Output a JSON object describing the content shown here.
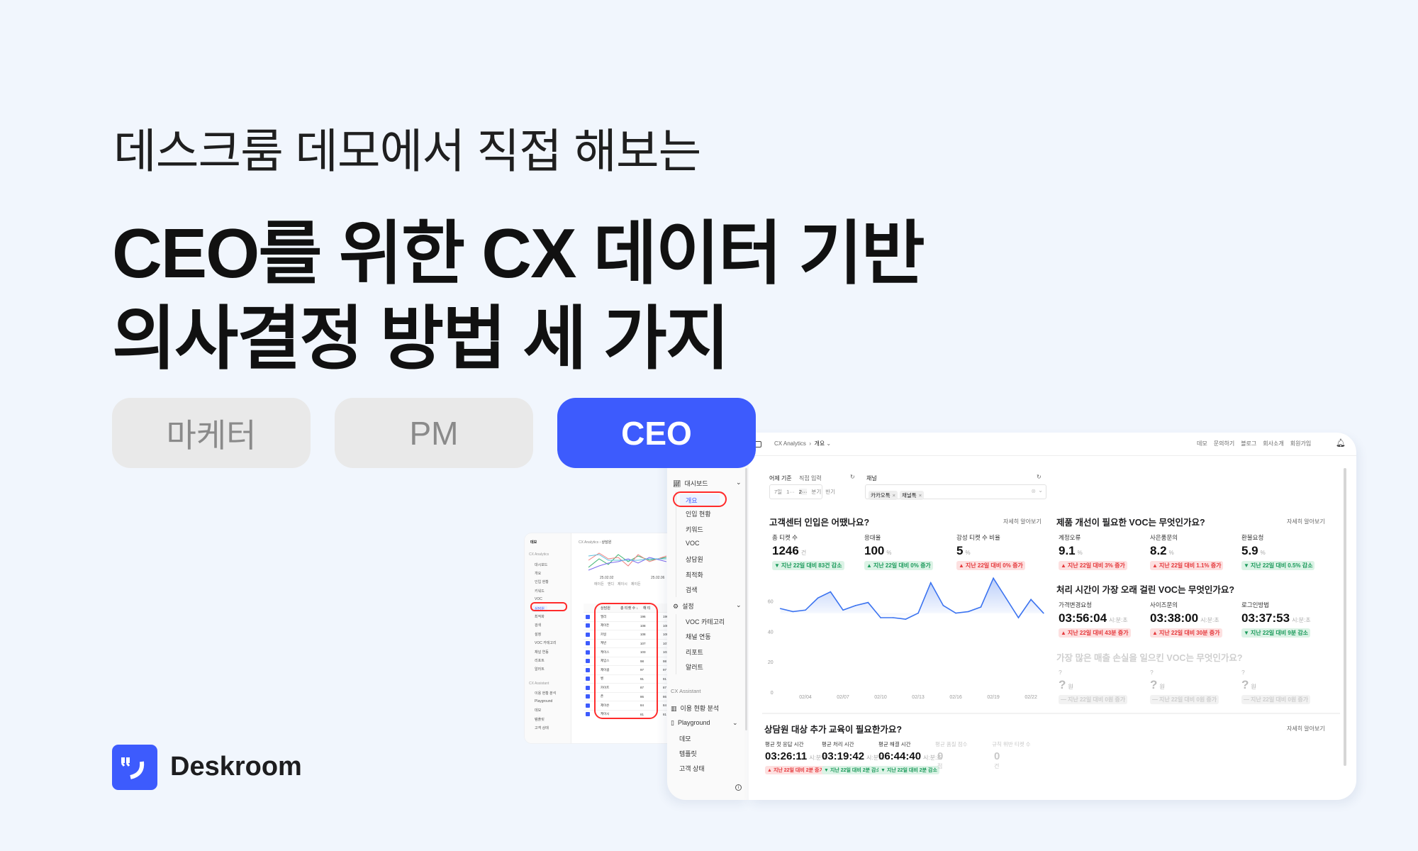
{
  "hero": {
    "subtitle": "데스크룸 데모에서 직접 해보는",
    "title_line1": "CEO를 위한 CX 데이터 기반",
    "title_line2": "의사결정 방법 세 가지"
  },
  "roles": [
    {
      "label": "마케터",
      "active": false
    },
    {
      "label": "PM",
      "active": false
    },
    {
      "label": "CEO",
      "active": true
    }
  ],
  "brand": {
    "name": "Deskroom",
    "color": "#3d5bfd",
    "icon": "quote-smile-logo"
  },
  "back_screenshot": {
    "workspace": "데모",
    "section_label": "CX Analytics",
    "breadcrumb": [
      "CX Analytics",
      "상담원"
    ],
    "sidebar": [
      "대시보드",
      "개요",
      "인입 현황",
      "키워드",
      "VOC",
      "상담원",
      "최적화",
      "검색",
      "설정",
      "VOC 카테고리",
      "채널 연동",
      "리포트",
      "알러트",
      "CX Assistant",
      "이용 현황 분석",
      "Playground",
      "데모",
      "템플릿",
      "고객 상태"
    ],
    "chart_dates": [
      "25.02.02",
      "25.02.06"
    ],
    "legend": [
      "에이든",
      "앤디",
      "제이시",
      "제이든"
    ],
    "table": {
      "headers": [
        "상담원",
        "총 티켓 수 ↓",
        "해 티"
      ],
      "rows": [
        [
          "엘리",
          "196",
          "196"
        ],
        [
          "제이든",
          "108",
          "108"
        ],
        [
          "카일",
          "108",
          "108"
        ],
        [
          "케빈",
          "107",
          "107"
        ],
        [
          "케이스",
          "103",
          "103"
        ],
        [
          "제임스",
          "98",
          "98"
        ],
        [
          "제이콥",
          "97",
          "97"
        ],
        [
          "벤",
          "91",
          "91"
        ],
        [
          "카이트",
          "87",
          "87"
        ],
        [
          "존",
          "86",
          "86"
        ],
        [
          "제이슨",
          "84",
          "84"
        ],
        [
          "케이시",
          "81",
          "81"
        ]
      ]
    }
  },
  "sidebar": {
    "section_label": "CX Analytics",
    "groups": [
      {
        "label": "대시보드",
        "icon": "chart-icon",
        "items": [
          "개요",
          "인입 현황",
          "키워드",
          "VOC",
          "상담원",
          "최적화",
          "검색"
        ]
      },
      {
        "label": "설정",
        "icon": "gear-icon",
        "items": [
          "VOC 카테고리",
          "채널 연동",
          "리포트",
          "알러트"
        ]
      }
    ],
    "assistant_label": "CX Assistant",
    "usage": "이용 현황 분석",
    "playground": {
      "label": "Playground",
      "items": [
        "데모",
        "템플릿",
        "고객 상태"
      ]
    },
    "selected": "개요"
  },
  "topbar": {
    "breadcrumb": [
      "CX Analytics",
      "개요"
    ],
    "nav": [
      "데모",
      "문의하기",
      "블로그",
      "회사소개",
      "회원가입"
    ]
  },
  "filters": {
    "date_label": "어제 기준",
    "date_custom": "직접 입력",
    "date_options": [
      "7일",
      "1···",
      "2···",
      "분기",
      "반기"
    ],
    "date_selected": "2···",
    "channel_label": "채널",
    "channels": [
      "카카오톡",
      "채널톡"
    ]
  },
  "more_label": "자세히 알아보기",
  "sections": {
    "inflow": {
      "title": "고객센터 인입은 어땠나요?",
      "metrics": [
        {
          "label": "총 티켓 수",
          "value": "1246",
          "unit": "건",
          "change": "지난 22일 대비 83건 감소",
          "trend": "down",
          "tone": "green"
        },
        {
          "label": "응대율",
          "value": "100",
          "unit": "%",
          "change": "지난 22일 대비 0% 증가",
          "trend": "up",
          "tone": "green"
        },
        {
          "label": "강성 티켓 수 비율",
          "value": "5",
          "unit": "%",
          "change": "지난 22일 대비 0% 증가",
          "trend": "up",
          "tone": "red"
        }
      ]
    },
    "voc": {
      "title": "제품 개선이 필요한 VOC는 무엇인가요?",
      "metrics": [
        {
          "label": "계정오류",
          "value": "9.1",
          "unit": "%",
          "change": "지난 22일 대비 3% 증가",
          "trend": "up",
          "tone": "red"
        },
        {
          "label": "사은품문의",
          "value": "8.2",
          "unit": "%",
          "change": "지난 22일 대비 1.1% 증가",
          "trend": "up",
          "tone": "red"
        },
        {
          "label": "환불요청",
          "value": "5.9",
          "unit": "%",
          "change": "지난 22일 대비 0.5% 감소",
          "trend": "down",
          "tone": "green"
        }
      ]
    },
    "time": {
      "title": "처리 시간이 가장 오래 걸린 VOC는 무엇인가요?",
      "metrics": [
        {
          "label": "가격변경요청",
          "value": "03:56:04",
          "unit": "시:분:초",
          "change": "지난 22일 대비 43분 증가",
          "trend": "up",
          "tone": "red"
        },
        {
          "label": "사이즈문의",
          "value": "03:38:00",
          "unit": "시:분:초",
          "change": "지난 22일 대비 30분 증가",
          "trend": "up",
          "tone": "red"
        },
        {
          "label": "로그인방법",
          "value": "03:37:53",
          "unit": "시:분:초",
          "change": "지난 22일 대비 9분 감소",
          "trend": "down",
          "tone": "green"
        }
      ]
    },
    "revenue": {
      "title": "가장 많은 매출 손실을 일으킨 VOC는 무엇인가요?",
      "metrics": [
        {
          "label": "?",
          "value": "?",
          "unit": "원",
          "change": "지난 22일 대비 0원 증가",
          "trend": "flat",
          "tone": "grey"
        },
        {
          "label": "?",
          "value": "?",
          "unit": "원",
          "change": "지난 22일 대비 0원 증가",
          "trend": "flat",
          "tone": "grey"
        },
        {
          "label": "?",
          "value": "?",
          "unit": "원",
          "change": "지난 22일 대비 0원 증가",
          "trend": "flat",
          "tone": "grey"
        }
      ]
    },
    "agent": {
      "title": "상담원 대상 추가 교육이 필요한가요?",
      "metrics": [
        {
          "label": "평균 첫 응답 시간",
          "value": "03:26:11",
          "unit": "시:분:초",
          "change": "지난 22일 대비 2분 증가",
          "trend": "up",
          "tone": "red"
        },
        {
          "label": "평균 처리 시간",
          "value": "03:19:42",
          "unit": "시:분:초",
          "change": "지난 22일 대비 2분 감소",
          "trend": "down",
          "tone": "green"
        },
        {
          "label": "평균 해결 시간",
          "value": "06:44:40",
          "unit": "시:분:초",
          "change": "지난 22일 대비 2분 감소",
          "trend": "down",
          "tone": "green"
        },
        {
          "label": "평균 품질 점수",
          "value": "0",
          "unit": "점",
          "dim": true
        },
        {
          "label": "규칙 위반 티켓 수",
          "value": "0",
          "unit": "건",
          "dim": true
        }
      ]
    }
  },
  "chart_data": {
    "type": "area",
    "x": [
      "02/02",
      "02/03",
      "02/04",
      "02/05",
      "02/06",
      "02/07",
      "02/08",
      "02/09",
      "02/10",
      "02/11",
      "02/12",
      "02/13",
      "02/14",
      "02/15",
      "02/16",
      "02/17",
      "02/18",
      "02/19",
      "02/20",
      "02/21",
      "02/22",
      "02/23"
    ],
    "values": [
      55,
      53,
      54,
      62,
      66,
      54,
      57,
      59,
      49,
      49,
      48,
      52,
      72,
      57,
      52,
      53,
      56,
      75,
      62,
      49,
      61,
      52
    ],
    "xticks": [
      "02/04",
      "02/07",
      "02/10",
      "02/13",
      "02/16",
      "02/19",
      "02/22"
    ],
    "yticks": [
      "0",
      "20",
      "40",
      "60"
    ],
    "ylim": [
      0,
      80
    ],
    "color": "#3b73f0",
    "grid": false
  }
}
